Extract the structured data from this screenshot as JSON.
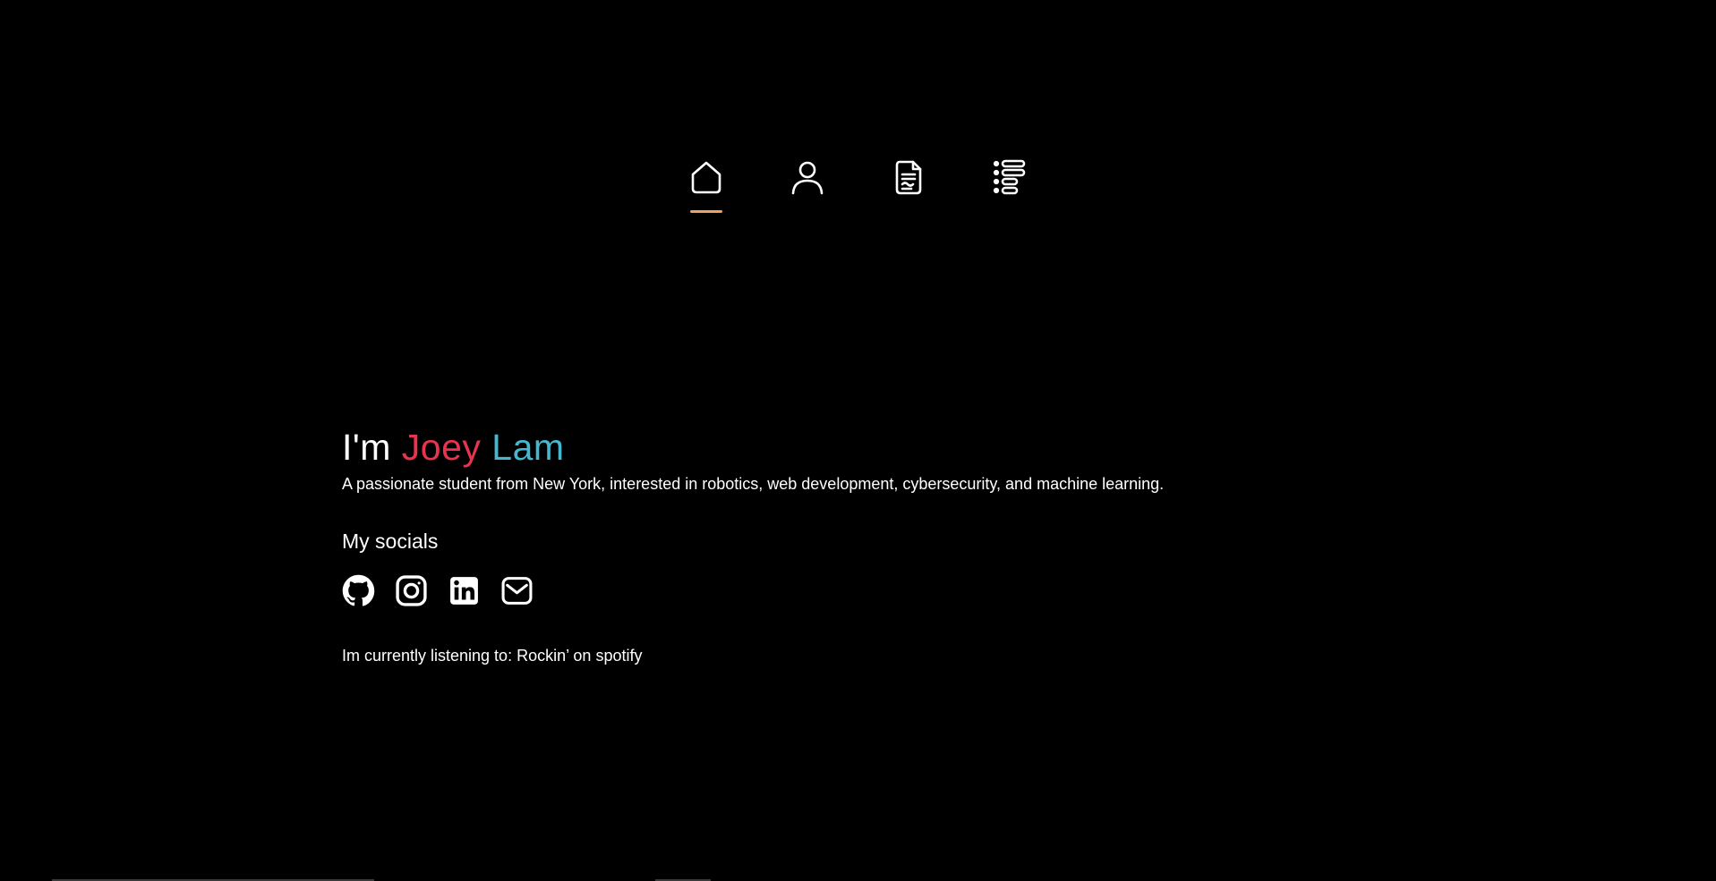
{
  "nav": {
    "items": [
      {
        "icon": "home-icon",
        "active": true
      },
      {
        "icon": "user-icon",
        "active": false
      },
      {
        "icon": "document-icon",
        "active": false
      },
      {
        "icon": "list-icon",
        "active": false
      }
    ],
    "active_color": "#f0a060"
  },
  "hero": {
    "prefix": "I'm ",
    "first_name": "Joey",
    "space": " ",
    "last_name": "Lam",
    "first_name_color": "#e8344e",
    "last_name_color": "#45b8cf",
    "tagline": "A passionate student from New York, interested in robotics, web development, cybersecurity, and machine learning."
  },
  "socials": {
    "heading": "My socials",
    "items": [
      {
        "icon": "github-icon"
      },
      {
        "icon": "instagram-icon"
      },
      {
        "icon": "linkedin-icon"
      },
      {
        "icon": "email-icon"
      }
    ]
  },
  "listening": {
    "text": "Im currently listening to: Rockin’ on spotify"
  }
}
